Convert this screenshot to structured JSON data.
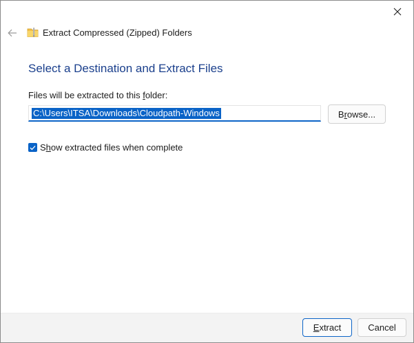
{
  "window": {
    "title": "Extract Compressed (Zipped) Folders",
    "icons": {
      "close": "close-icon",
      "back": "back-arrow-icon",
      "title": "zip-folder-icon"
    }
  },
  "page": {
    "heading": "Select a Destination and Extract Files",
    "destination_label": "Files will be extracted to this folder:",
    "destination_path": "C:\\Users\\ITSA\\Downloads\\Cloudpath-Windows",
    "browse_label": "Browse...",
    "show_files": {
      "checked": true,
      "label": "Show extracted files when complete"
    }
  },
  "footer": {
    "extract_label": "Extract",
    "cancel_label": "Cancel"
  },
  "colors": {
    "accent": "#0a63c7",
    "heading": "#1a3f8c",
    "footer_bg": "#f3f3f3"
  }
}
